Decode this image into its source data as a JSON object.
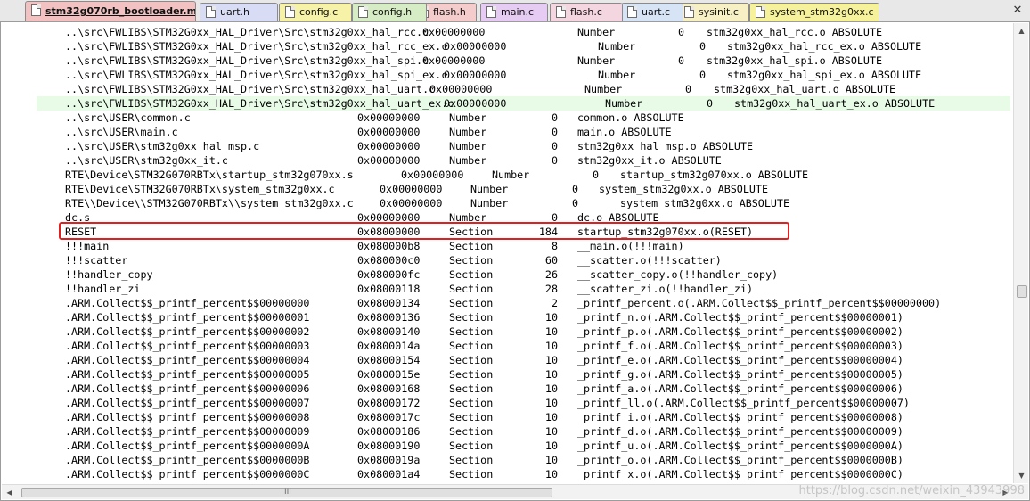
{
  "tabs": [
    {
      "label": "stm32g070rb_bootloader.map",
      "color": "#f2c2c2",
      "active": true
    },
    {
      "label": "uart.h",
      "color": "#d8dcf4"
    },
    {
      "label": "config.c",
      "color": "#f6f2a8"
    },
    {
      "label": "config.h",
      "color": "#d6ecc4"
    },
    {
      "label": "flash.h",
      "color": "#f4cccc"
    },
    {
      "label": "main.c",
      "color": "#e6ccf2"
    },
    {
      "label": "flash.c",
      "color": "#f4d6e0"
    },
    {
      "label": "uart.c",
      "color": "#d6e4f6"
    },
    {
      "label": "sysinit.c",
      "color": "#f6f0c4"
    },
    {
      "label": "system_stm32g0xx.c",
      "color": "#f6f29c"
    }
  ],
  "close_glyph": "✕",
  "editor": {
    "lines": [
      {
        "c": [
          "..\\src\\FWLIBS\\STM32G0xx_HAL_Driver\\Src\\stm32g0xx_hal_rcc.c",
          "0x00000000",
          "Number",
          "0",
          "stm32g0xx_hal_rcc.o ABSOLUTE"
        ]
      },
      {
        "c": [
          "..\\src\\FWLIBS\\STM32G0xx_HAL_Driver\\Src\\stm32g0xx_hal_rcc_ex.c",
          "0x00000000",
          "Number",
          "0",
          "stm32g0xx_hal_rcc_ex.o ABSOLUTE"
        ]
      },
      {
        "c": [
          "..\\src\\FWLIBS\\STM32G0xx_HAL_Driver\\Src\\stm32g0xx_hal_spi.c",
          "0x00000000",
          "Number",
          "0",
          "stm32g0xx_hal_spi.o ABSOLUTE"
        ]
      },
      {
        "c": [
          "..\\src\\FWLIBS\\STM32G0xx_HAL_Driver\\Src\\stm32g0xx_hal_spi_ex.c",
          "0x00000000",
          "Number",
          "0",
          "stm32g0xx_hal_spi_ex.o ABSOLUTE"
        ]
      },
      {
        "c": [
          "..\\src\\FWLIBS\\STM32G0xx_HAL_Driver\\Src\\stm32g0xx_hal_uart.c",
          "0x00000000",
          "Number",
          "0",
          "stm32g0xx_hal_uart.o ABSOLUTE"
        ]
      },
      {
        "c": [
          "..\\src\\FWLIBS\\STM32G0xx_HAL_Driver\\Src\\stm32g0xx_hal_uart_ex.c",
          "0x00000000",
          "Number",
          "0",
          "stm32g0xx_hal_uart_ex.o ABSOLUTE"
        ],
        "hl": true
      },
      {
        "c": [
          "..\\src\\USER\\common.c",
          "0x00000000",
          "Number",
          "0",
          "common.o ABSOLUTE"
        ]
      },
      {
        "c": [
          "..\\src\\USER\\main.c",
          "0x00000000",
          "Number",
          "0",
          "main.o ABSOLUTE"
        ]
      },
      {
        "c": [
          "..\\src\\USER\\stm32g0xx_hal_msp.c",
          "0x00000000",
          "Number",
          "0",
          "stm32g0xx_hal_msp.o ABSOLUTE"
        ]
      },
      {
        "c": [
          "..\\src\\USER\\stm32g0xx_it.c",
          "0x00000000",
          "Number",
          "0",
          "stm32g0xx_it.o ABSOLUTE"
        ]
      },
      {
        "c": [
          "RTE\\Device\\STM32G070RBTx\\startup_stm32g070xx.s",
          "0x00000000",
          "Number",
          "0",
          "startup_stm32g070xx.o ABSOLUTE"
        ]
      },
      {
        "c": [
          "RTE\\Device\\STM32G070RBTx\\system_stm32g0xx.c",
          "0x00000000",
          "Number",
          "0",
          "system_stm32g0xx.o ABSOLUTE"
        ]
      },
      {
        "c": [
          "RTE\\\\Device\\\\STM32G070RBTx\\\\system_stm32g0xx.c",
          "0x00000000",
          "Number",
          "0",
          "system_stm32g0xx.o ABSOLUTE"
        ]
      },
      {
        "c": [
          "dc.s",
          "0x00000000",
          "Number",
          "0",
          "dc.o ABSOLUTE"
        ]
      },
      {
        "c": [
          "RESET",
          "0x08000000",
          "Section",
          "184",
          "startup_stm32g070xx.o(RESET)"
        ],
        "boxed": true
      },
      {
        "c": [
          "!!!main",
          "0x080000b8",
          "Section",
          "8",
          "__main.o(!!!main)"
        ]
      },
      {
        "c": [
          "!!!scatter",
          "0x080000c0",
          "Section",
          "60",
          "__scatter.o(!!!scatter)"
        ]
      },
      {
        "c": [
          "!!handler_copy",
          "0x080000fc",
          "Section",
          "26",
          "__scatter_copy.o(!!handler_copy)"
        ]
      },
      {
        "c": [
          "!!handler_zi",
          "0x08000118",
          "Section",
          "28",
          "__scatter_zi.o(!!handler_zi)"
        ]
      },
      {
        "c": [
          ".ARM.Collect$$_printf_percent$$00000000",
          "0x08000134",
          "Section",
          "2",
          "_printf_percent.o(.ARM.Collect$$_printf_percent$$00000000)"
        ]
      },
      {
        "c": [
          ".ARM.Collect$$_printf_percent$$00000001",
          "0x08000136",
          "Section",
          "10",
          "_printf_n.o(.ARM.Collect$$_printf_percent$$00000001)"
        ]
      },
      {
        "c": [
          ".ARM.Collect$$_printf_percent$$00000002",
          "0x08000140",
          "Section",
          "10",
          "_printf_p.o(.ARM.Collect$$_printf_percent$$00000002)"
        ]
      },
      {
        "c": [
          ".ARM.Collect$$_printf_percent$$00000003",
          "0x0800014a",
          "Section",
          "10",
          "_printf_f.o(.ARM.Collect$$_printf_percent$$00000003)"
        ]
      },
      {
        "c": [
          ".ARM.Collect$$_printf_percent$$00000004",
          "0x08000154",
          "Section",
          "10",
          "_printf_e.o(.ARM.Collect$$_printf_percent$$00000004)"
        ]
      },
      {
        "c": [
          ".ARM.Collect$$_printf_percent$$00000005",
          "0x0800015e",
          "Section",
          "10",
          "_printf_g.o(.ARM.Collect$$_printf_percent$$00000005)"
        ]
      },
      {
        "c": [
          ".ARM.Collect$$_printf_percent$$00000006",
          "0x08000168",
          "Section",
          "10",
          "_printf_a.o(.ARM.Collect$$_printf_percent$$00000006)"
        ]
      },
      {
        "c": [
          ".ARM.Collect$$_printf_percent$$00000007",
          "0x08000172",
          "Section",
          "10",
          "_printf_ll.o(.ARM.Collect$$_printf_percent$$00000007)"
        ]
      },
      {
        "c": [
          ".ARM.Collect$$_printf_percent$$00000008",
          "0x0800017c",
          "Section",
          "10",
          "_printf_i.o(.ARM.Collect$$_printf_percent$$00000008)"
        ]
      },
      {
        "c": [
          ".ARM.Collect$$_printf_percent$$00000009",
          "0x08000186",
          "Section",
          "10",
          "_printf_d.o(.ARM.Collect$$_printf_percent$$00000009)"
        ]
      },
      {
        "c": [
          ".ARM.Collect$$_printf_percent$$0000000A",
          "0x08000190",
          "Section",
          "10",
          "_printf_u.o(.ARM.Collect$$_printf_percent$$0000000A)"
        ]
      },
      {
        "c": [
          ".ARM.Collect$$_printf_percent$$0000000B",
          "0x0800019a",
          "Section",
          "10",
          "_printf_o.o(.ARM.Collect$$_printf_percent$$0000000B)"
        ]
      },
      {
        "c": [
          ".ARM.Collect$$_printf_percent$$0000000C",
          "0x080001a4",
          "Section",
          "10",
          "_printf_x.o(.ARM.Collect$$_printf_percent$$0000000C)"
        ]
      }
    ]
  },
  "scrollbar": {
    "up": "▲",
    "down": "▼",
    "left": "◀",
    "right": "▶",
    "grip": "III"
  },
  "watermark": "https://blog.csdn.net/weixin_43943998",
  "colors": {
    "highlight_row": "#e7fbe7",
    "reset_box": "#e02020"
  }
}
